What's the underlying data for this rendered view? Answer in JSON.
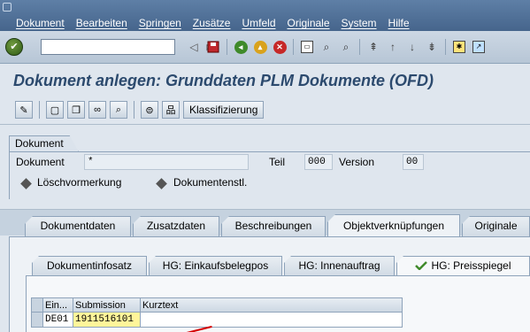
{
  "menu": {
    "items": [
      "Dokument",
      "Bearbeiten",
      "Springen",
      "Zusätze",
      "Umfeld",
      "Originale",
      "System",
      "Hilfe"
    ]
  },
  "toolbar": {
    "command_value": "",
    "icons": [
      "ok-icon",
      "back-icon",
      "save-icon",
      "nav-back-icon",
      "exit-icon",
      "cancel-icon",
      "print-icon",
      "find-icon",
      "find-next-icon",
      "first-page-icon",
      "prev-page-icon",
      "next-page-icon",
      "last-page-icon",
      "new-session-icon",
      "shortcut-icon"
    ]
  },
  "title": "Dokument anlegen: Grunddaten PLM Dokumente (OFD)",
  "app_toolbar": {
    "klassifizierung_label": "Klassifizierung"
  },
  "document": {
    "group_label": "Dokument",
    "dokument_label": "Dokument",
    "dokument_value": "*",
    "teil_label": "Teil",
    "teil_value": "000",
    "version_label": "Version",
    "version_value": "00",
    "loeschvormerkung": "Löschvormerkung",
    "dokumentenstatus": "Dokumentenstl."
  },
  "tabs": [
    "Dokumentdaten",
    "Zusatzdaten",
    "Beschreibungen",
    "Objektverknüpfungen",
    "Originale"
  ],
  "active_tab": "Objektverknüpfungen",
  "subtabs": [
    "Dokumentinfosatz",
    "HG: Einkaufsbelegpos",
    "HG: Innenauftrag",
    "HG: Preisspiegel"
  ],
  "active_subtab": "HG: Preisspiegel",
  "table": {
    "headers": [
      "Ein...",
      "Submission",
      "Kurztext"
    ],
    "rows": [
      {
        "ein": "DE01",
        "submission": "1911516101",
        "kurztext": ""
      }
    ]
  },
  "colors": {
    "menubar": "#4f6f96",
    "title": "#2c4a6e",
    "highlight": "#fff59a",
    "annotation": "#d40000"
  }
}
